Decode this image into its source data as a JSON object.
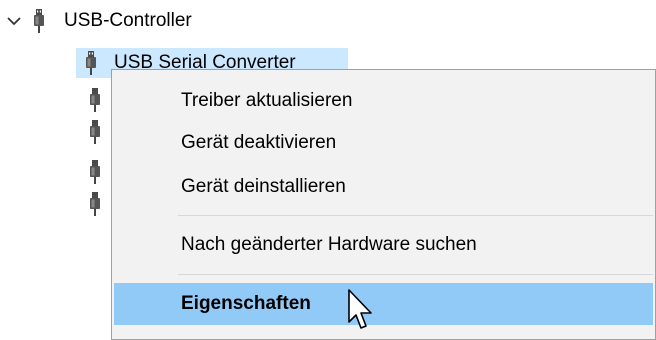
{
  "tree": {
    "root": {
      "label": "USB-Controller",
      "expand_icon": "chevron-down-icon",
      "icon": "usb-plug-icon"
    },
    "selected_child": {
      "label": "USB Serial Converter",
      "icon": "usb-plug-icon"
    },
    "hidden_children_icons": [
      "usb-plug-icon",
      "usb-plug-icon",
      "usb-plug-icon",
      "usb-plug-icon"
    ]
  },
  "context_menu": {
    "items": [
      {
        "label": "Treiber aktualisieren"
      },
      {
        "label": "Gerät deaktivieren"
      },
      {
        "label": "Gerät deinstallieren"
      },
      {
        "label": "Nach geänderter Hardware suchen"
      },
      {
        "label": "Eigenschaften",
        "highlighted": true
      }
    ]
  },
  "colors": {
    "selection_bg": "#cce8ff",
    "menu_bg": "#f2f2f2",
    "menu_highlight": "#91c9f7"
  }
}
